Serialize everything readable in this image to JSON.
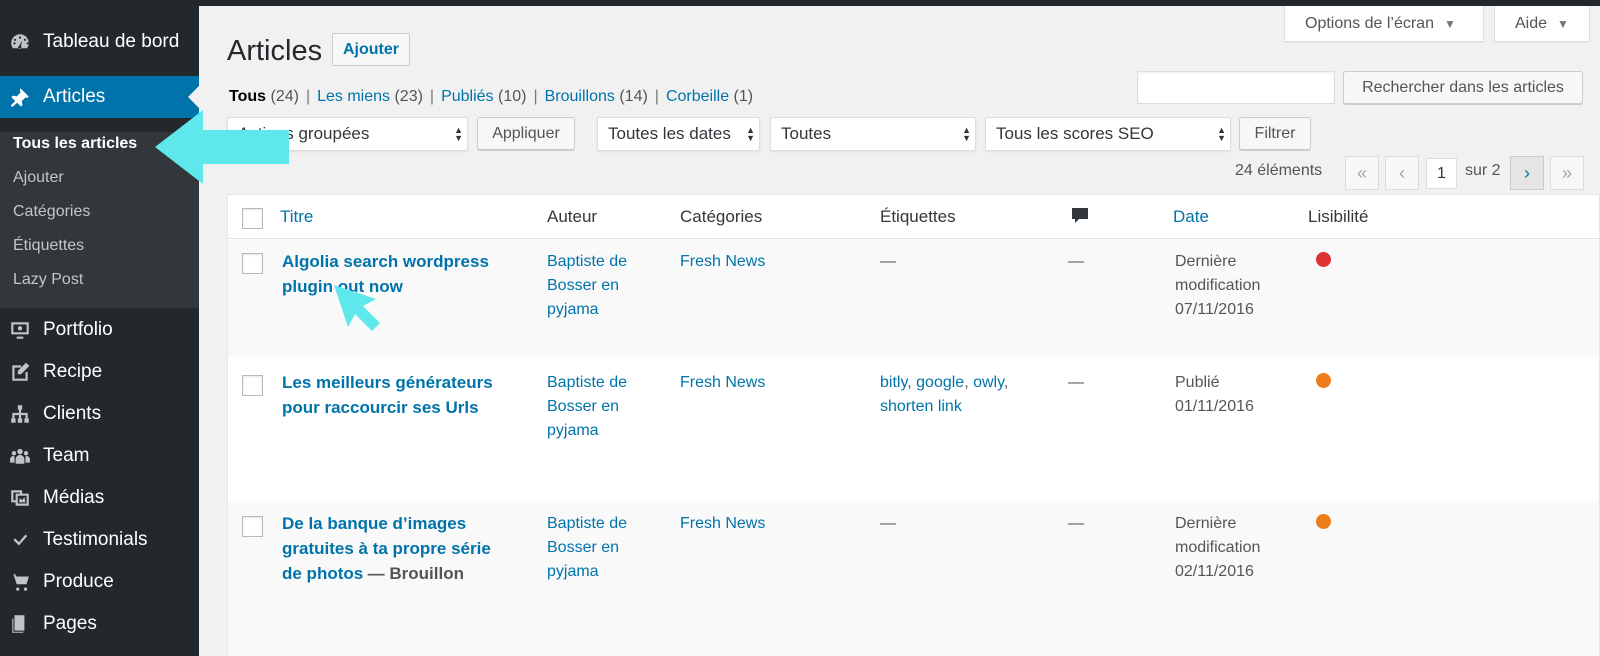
{
  "colors": {
    "admin_dark": "#23282d",
    "accent": "#0073aa",
    "annotation": "#5ee8ec",
    "readability_bad": "#dc3232",
    "readability_ok": "#ee7c1b"
  },
  "sidebar": {
    "dashboard": "Tableau de bord",
    "articles": "Articles",
    "submenu": [
      "Tous les articles",
      "Ajouter",
      "Catégories",
      "Étiquettes",
      "Lazy Post"
    ],
    "items": [
      "Portfolio",
      "Recipe",
      "Clients",
      "Team",
      "Médias",
      "Testimonials",
      "Produce",
      "Pages"
    ]
  },
  "screen_options": {
    "options_label": "Options de l’écran",
    "help_label": "Aide"
  },
  "header": {
    "title": "Articles",
    "add_new": "Ajouter"
  },
  "filters": {
    "all": {
      "label": "Tous",
      "count": "(24)"
    },
    "mine": {
      "label": "Les miens",
      "count": "(23)"
    },
    "published": {
      "label": "Publiés",
      "count": "(10)"
    },
    "drafts": {
      "label": "Brouillons",
      "count": "(14)"
    },
    "trash": {
      "label": "Corbeille",
      "count": "(1)"
    }
  },
  "search": {
    "value": "",
    "button": "Rechercher dans les articles"
  },
  "bulk": {
    "selected": "Actions groupées",
    "apply": "Appliquer"
  },
  "dates_filter": "Toutes les dates",
  "category_filter": "Toutes",
  "seo_filter": "Tous les scores SEO",
  "filter_button": "Filtrer",
  "pagination": {
    "items": "24 éléments",
    "first": "«",
    "prev": "‹",
    "current": "1",
    "of": "sur 2",
    "next": "›",
    "last": "»"
  },
  "columns": {
    "title": "Titre",
    "author": "Auteur",
    "categories": "Catégories",
    "tags": "Étiquettes",
    "date": "Date",
    "readability": "Lisibilité"
  },
  "rows": [
    {
      "title_l1": "Algolia search wordpress",
      "title_l2": "plugin out now",
      "title_l3": "",
      "state": "",
      "author_l1": "Baptiste de",
      "author_l2": "Bosser en",
      "author_l3": "pyjama",
      "category": "Fresh News",
      "tags": "—",
      "tag1": "",
      "tag2": "",
      "tag3": "",
      "tag4": "",
      "comments": "—",
      "date_l1": "Dernière",
      "date_l2": "modification",
      "date_l3": "07/11/2016",
      "readability": "red"
    },
    {
      "title_l1": "Les meilleurs générateurs",
      "title_l2": "pour raccourcir ses Urls",
      "title_l3": "",
      "state": "",
      "author_l1": "Baptiste de",
      "author_l2": "Bosser en",
      "author_l3": "pyjama",
      "category": "Fresh News",
      "tags": "",
      "tag1": "bitly",
      "tag2": "google",
      "tag3": "owly",
      "tag4": "shorten link",
      "comments": "—",
      "date_l1": "Publié",
      "date_l2": "01/11/2016",
      "date_l3": "",
      "readability": "orange"
    },
    {
      "title_l1": "De la banque d’images",
      "title_l2": "gratuites à ta propre série",
      "title_l3": "de photos",
      "state": "— Brouillon",
      "author_l1": "Baptiste de",
      "author_l2": "Bosser en",
      "author_l3": "pyjama",
      "category": "Fresh News",
      "tags": "—",
      "tag1": "",
      "tag2": "",
      "tag3": "",
      "tag4": "",
      "comments": "—",
      "date_l1": "Dernière",
      "date_l2": "modification",
      "date_l3": "02/11/2016",
      "readability": "orange"
    }
  ]
}
